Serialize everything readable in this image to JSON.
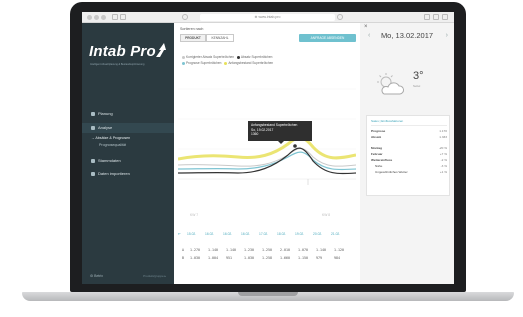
{
  "browser": {
    "url": "⊕ www.intab.pro"
  },
  "app": {
    "logo": "Intab Pro",
    "logo_tagline": "Intelligent Absatzplanung & Bestandsoptimierung"
  },
  "sidebar": {
    "items": [
      {
        "label": "Planung",
        "icon": "calendar-icon"
      },
      {
        "label": "Analyse",
        "icon": "chart-icon"
      },
      {
        "label": "Stammdaten",
        "icon": "database-icon"
      },
      {
        "label": "Daten importieren",
        "icon": "upload-icon"
      }
    ],
    "subitems": [
      {
        "label": "→ Absätze & Prognosen"
      },
      {
        "label": "Prognosequalität"
      }
    ],
    "footer_user": "⚙ Betrix",
    "footer_right": "Produkt/gruppe ▸"
  },
  "main": {
    "sort_label": "Sortieren nach",
    "seg_buttons": [
      "PRODUKT",
      "KENNZAHL"
    ],
    "request_button": "ANFRAGE ABSENDEN",
    "legend": [
      {
        "label": "Korrigierter Absatz Superbrötchen",
        "color": "#c9c9c9"
      },
      {
        "label": "Absatz Superbrötchen",
        "color": "#333333"
      },
      {
        "label": "Prognose Superbrötchen",
        "color": "#7ec4d2"
      },
      {
        "label": "Anfangsbestand Superbrötchen",
        "color": "#e7e15a"
      }
    ],
    "tooltip": {
      "title": "Anfangsbestand Superbrötchen",
      "date": "So, 19.02.2017",
      "value": "1360"
    },
    "axis_marker_left": "KW 7",
    "axis_marker_right": "KW 8",
    "ticks": [
      "15.02.",
      "16.02.",
      "16.02.",
      "16.02.",
      "17.02.",
      "18.02.",
      "19.02.",
      "20.02.",
      "21.02."
    ],
    "rows": [
      {
        "label": "A",
        "values": [
          "1.270",
          "1.140",
          "1.140",
          "1.230",
          "1.250",
          "2.010",
          "1.070",
          "1.140",
          "1.120"
        ]
      },
      {
        "label": "B",
        "values": [
          "1.030",
          "1.004",
          "951",
          "1.030",
          "1.258",
          "1.660",
          "1.150",
          "979",
          "984"
        ]
      }
    ]
  },
  "panel": {
    "date": "Mo, 13.02.2017",
    "temperature": "3°",
    "temperature_label": "Nebel",
    "weather_icon": "cloud-sun-icon",
    "card_title": "Sales | Einflussfaktoren",
    "stats": [
      {
        "k": "Prognose",
        "v": "1.170"
      },
      {
        "k": "Absatz",
        "v": "1.333"
      }
    ],
    "factors": [
      {
        "k": "Montag",
        "v": "-20 %"
      },
      {
        "k": "Februar",
        "v": "+7 %"
      },
      {
        "k": "Wettereinfluss",
        "v": "-2 %"
      },
      {
        "k": "Nähe",
        "v": "-3 %"
      },
      {
        "k": "Ungewöhnliches Wetter",
        "v": "+1 %"
      }
    ]
  },
  "device": {
    "brand": "MacBook"
  },
  "colors": {
    "sidebar": "#2b3a40",
    "accent": "#6fc1cf",
    "prognose": "#7ec4d2",
    "anfangsbestand": "#e7e15a",
    "absatz": "#333333"
  }
}
